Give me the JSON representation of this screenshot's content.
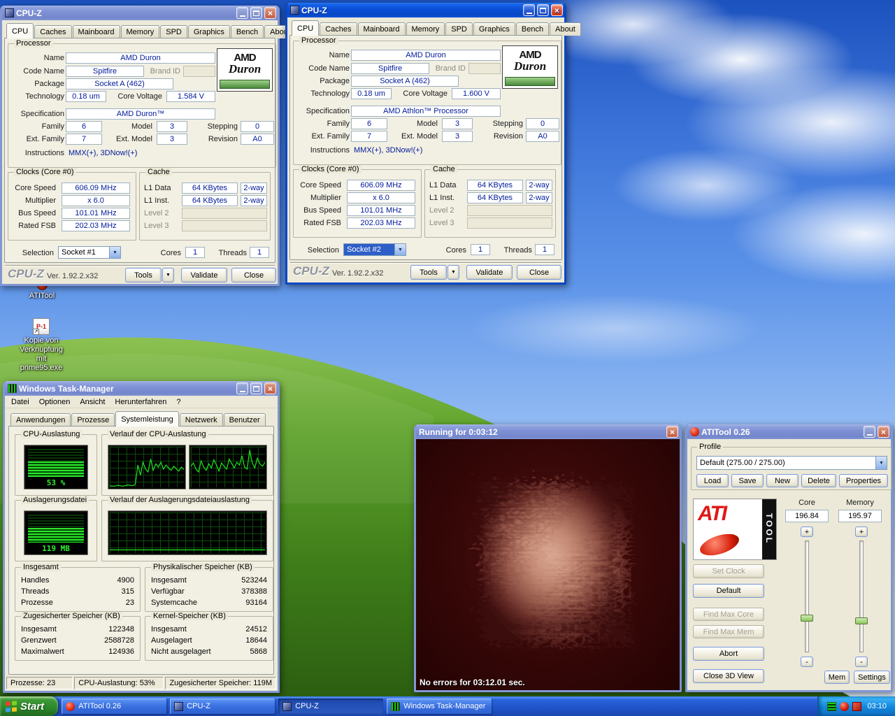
{
  "desktop": {
    "icons": [
      {
        "label": "ATITool"
      },
      {
        "label1": "Kopie von Verknüpfung",
        "label2": "mit prime95.exe"
      }
    ]
  },
  "cpuz1": {
    "title": "CPU-Z",
    "tabs": [
      "CPU",
      "Caches",
      "Mainboard",
      "Memory",
      "SPD",
      "Graphics",
      "Bench",
      "About"
    ],
    "proc": {
      "group": "Processor",
      "l_name": "Name",
      "name": "AMD Duron",
      "l_code": "Code Name",
      "code": "Spitfire",
      "l_brand": "Brand ID",
      "l_package": "Package",
      "package": "Socket A (462)",
      "l_tech": "Technology",
      "tech": "0.18 um",
      "l_volt": "Core Voltage",
      "volt": "1.584 V",
      "l_spec": "Specification",
      "spec": "AMD Duron™",
      "l_family": "Family",
      "family": "6",
      "l_model": "Model",
      "model": "3",
      "l_stepping": "Stepping",
      "stepping": "0",
      "l_extfamily": "Ext. Family",
      "extfamily": "7",
      "l_extmodel": "Ext. Model",
      "extmodel": "3",
      "l_revision": "Revision",
      "revision": "A0",
      "l_instr": "Instructions",
      "instr": "MMX(+), 3DNow!(+)",
      "logo1": "AMD",
      "logo2": "Duron"
    },
    "clocks": {
      "group": "Clocks (Core #0)",
      "l_core": "Core Speed",
      "core": "606.09 MHz",
      "l_mult": "Multiplier",
      "mult": "x 6.0",
      "l_bus": "Bus Speed",
      "bus": "101.01 MHz",
      "l_fsb": "Rated FSB",
      "fsb": "202.03 MHz"
    },
    "cache": {
      "group": "Cache",
      "l_l1d": "L1 Data",
      "l1d": "64 KBytes",
      "l1d_assoc": "2-way",
      "l_l1i": "L1 Inst.",
      "l1i": "64 KBytes",
      "l1i_assoc": "2-way",
      "l_l2": "Level 2",
      "l_l3": "Level 3"
    },
    "sel": {
      "l_selection": "Selection",
      "selection": "Socket #1",
      "l_cores": "Cores",
      "cores": "1",
      "l_threads": "Threads",
      "threads": "1"
    },
    "footer": {
      "brand": "CPU-Z",
      "version": "Ver. 1.92.2.x32",
      "tools": "Tools",
      "validate": "Validate",
      "close": "Close"
    }
  },
  "cpuz2": {
    "title": "CPU-Z",
    "tabs": [
      "CPU",
      "Caches",
      "Mainboard",
      "Memory",
      "SPD",
      "Graphics",
      "Bench",
      "About"
    ],
    "proc": {
      "group": "Processor",
      "l_name": "Name",
      "name": "AMD Duron",
      "l_code": "Code Name",
      "code": "Spitfire",
      "l_brand": "Brand ID",
      "l_package": "Package",
      "package": "Socket A (462)",
      "l_tech": "Technology",
      "tech": "0.18 um",
      "l_volt": "Core Voltage",
      "volt": "1.600 V",
      "l_spec": "Specification",
      "spec": "AMD Athlon™ Processor",
      "l_family": "Family",
      "family": "6",
      "l_model": "Model",
      "model": "3",
      "l_stepping": "Stepping",
      "stepping": "0",
      "l_extfamily": "Ext. Family",
      "extfamily": "7",
      "l_extmodel": "Ext. Model",
      "extmodel": "3",
      "l_revision": "Revision",
      "revision": "A0",
      "l_instr": "Instructions",
      "instr": "MMX(+), 3DNow!(+)",
      "logo1": "AMD",
      "logo2": "Duron"
    },
    "clocks": {
      "group": "Clocks (Core #0)",
      "l_core": "Core Speed",
      "core": "606.09 MHz",
      "l_mult": "Multiplier",
      "mult": "x 6.0",
      "l_bus": "Bus Speed",
      "bus": "101.01 MHz",
      "l_fsb": "Rated FSB",
      "fsb": "202.03 MHz"
    },
    "cache": {
      "group": "Cache",
      "l_l1d": "L1 Data",
      "l1d": "64 KBytes",
      "l1d_assoc": "2-way",
      "l_l1i": "L1 Inst.",
      "l1i": "64 KBytes",
      "l1i_assoc": "2-way",
      "l_l2": "Level 2",
      "l_l3": "Level 3"
    },
    "sel": {
      "l_selection": "Selection",
      "selection": "Socket #2",
      "l_cores": "Cores",
      "cores": "1",
      "l_threads": "Threads",
      "threads": "1"
    },
    "footer": {
      "brand": "CPU-Z",
      "version": "Ver. 1.92.2.x32",
      "tools": "Tools",
      "validate": "Validate",
      "close": "Close"
    }
  },
  "taskman": {
    "title": "Windows Task-Manager",
    "menu": [
      "Datei",
      "Optionen",
      "Ansicht",
      "Herunterfahren",
      "?"
    ],
    "tabs": [
      "Anwendungen",
      "Prozesse",
      "Systemleistung",
      "Netzwerk",
      "Benutzer"
    ],
    "groups": {
      "cpu": "CPU-Auslastung",
      "cpu_value": "53 %",
      "cpu_hist": "Verlauf der CPU-Auslastung",
      "pf": "Auslagerungsdatei",
      "pf_value": "119 MB",
      "pf_hist": "Verlauf der Auslagerungsdateiauslastung"
    },
    "totals": {
      "title": "Insgesamt",
      "r0l": "Handles",
      "r0v": "4900",
      "r1l": "Threads",
      "r1v": "315",
      "r2l": "Prozesse",
      "r2v": "23"
    },
    "phys": {
      "title": "Physikalischer Speicher (KB)",
      "r0l": "Insgesamt",
      "r0v": "523244",
      "r1l": "Verfügbar",
      "r1v": "378388",
      "r2l": "Systemcache",
      "r2v": "93164"
    },
    "commit": {
      "title": "Zugesicherter Speicher (KB)",
      "r0l": "Insgesamt",
      "r0v": "122348",
      "r1l": "Grenzwert",
      "r1v": "2588728",
      "r2l": "Maximalwert",
      "r2v": "124936"
    },
    "kernel": {
      "title": "Kernel-Speicher (KB)",
      "r0l": "Insgesamt",
      "r0v": "24512",
      "r1l": "Ausgelagert",
      "r1v": "18644",
      "r2l": "Nicht ausgelagert",
      "r2v": "5868"
    },
    "status": [
      "Prozesse: 23",
      "CPU-Auslastung: 53%",
      "Zugesicherter Speicher: 119M"
    ],
    "cpu_history_1": [
      4,
      3,
      3,
      5,
      4,
      3,
      4,
      6,
      5,
      4,
      8,
      55,
      30,
      62,
      45,
      38,
      70,
      42,
      58,
      50,
      62,
      45,
      55,
      48,
      42,
      52,
      46,
      40,
      50,
      44
    ],
    "cpu_history_2": [
      52,
      60,
      45,
      38,
      65,
      50,
      42,
      58,
      48,
      68,
      55,
      40,
      60,
      52,
      45,
      70,
      58,
      48,
      62,
      55,
      78,
      50,
      45,
      92,
      60,
      48,
      72,
      58,
      52,
      62
    ],
    "pagefile_history": [
      8,
      8,
      8,
      8,
      8,
      8,
      8,
      8,
      8,
      8,
      8,
      8,
      8,
      8,
      8,
      8,
      8,
      8,
      8,
      8,
      8,
      8,
      8,
      8,
      8,
      8,
      8,
      8,
      8,
      8
    ]
  },
  "render": {
    "title": "Running for 0:03:12",
    "status": "No errors for 03:12.01 sec."
  },
  "atitool": {
    "title": "ATITool 0.26",
    "profile": {
      "legend": "Profile",
      "value": "Default (275.00 / 275.00)",
      "load": "Load",
      "save": "Save",
      "new": "New",
      "delete": "Delete",
      "properties": "Properties"
    },
    "core_label": "Core",
    "core_value": "196.84",
    "mem_label": "Memory",
    "mem_value": "195.97",
    "plus": "+",
    "minus": "-",
    "buttons": {
      "set_clock": "Set Clock",
      "default": "Default",
      "find_max_core": "Find Max Core",
      "find_max_mem": "Find Max Mem",
      "abort": "Abort",
      "close_3d": "Close 3D View",
      "mem": "Mem",
      "settings": "Settings"
    },
    "logo": {
      "ati": "ATI",
      "tool": "TOOL"
    }
  },
  "taskbar": {
    "start": "Start",
    "items": [
      {
        "label": "ATITool 0.26"
      },
      {
        "label": "CPU-Z"
      },
      {
        "label": "CPU-Z"
      },
      {
        "label": "Windows Task-Manager"
      }
    ],
    "clock": "03:10"
  }
}
